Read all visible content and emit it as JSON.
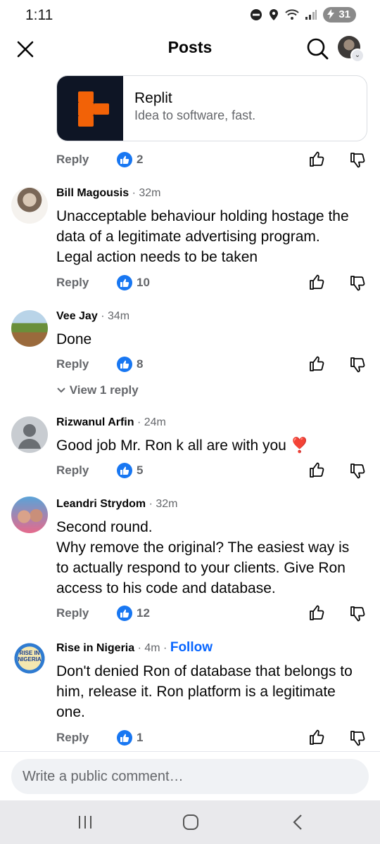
{
  "status_bar": {
    "time": "1:11",
    "battery": "31"
  },
  "header": {
    "title": "Posts"
  },
  "ad": {
    "name": "Replit",
    "tagline": "Idea to software, fast."
  },
  "ad_actions": {
    "reply_label": "Reply",
    "reaction_count": "2"
  },
  "comments": [
    {
      "author": "Bill Magousis",
      "time": "· 32m",
      "text": "Unacceptable behaviour holding hostage the data of a legitimate advertising program. Legal action needs to be taken",
      "reply_label": "Reply",
      "reaction_count": "10"
    },
    {
      "author": "Vee Jay",
      "time": "· 34m",
      "text": "Done",
      "reply_label": "Reply",
      "reaction_count": "8",
      "view_replies": "View 1 reply"
    },
    {
      "author": "Rizwanul Arfin",
      "time": "· 24m",
      "text": "Good job Mr. Ron k all are with you ❣️",
      "reply_label": "Reply",
      "reaction_count": "5"
    },
    {
      "author": "Leandri Strydom",
      "time": "· 32m",
      "text": "Second round.\nWhy remove the original? The easiest way is to actually respond to your clients. Give Ron access to his code and database.",
      "reply_label": "Reply",
      "reaction_count": "12"
    },
    {
      "author": "Rise in Nigeria",
      "time": "· 4m ·",
      "follow_label": "Follow",
      "text": "Don't denied Ron of database that belongs to him, release it. Ron platform is a legitimate one.",
      "reply_label": "Reply",
      "reaction_count": "1",
      "avatar_text": "RISE IN NIGERIA"
    }
  ],
  "composer": {
    "placeholder": "Write a public comment…"
  },
  "colors": {
    "accent": "#0866ff",
    "like": "#1877f2",
    "brand_orange": "#f26207",
    "brand_dark": "#0e1525"
  },
  "icons": [
    "close-icon",
    "search-icon",
    "thumbs-up-icon",
    "thumbs-down-icon",
    "like-reaction-icon",
    "chevron-down-icon",
    "default-avatar-icon"
  ]
}
